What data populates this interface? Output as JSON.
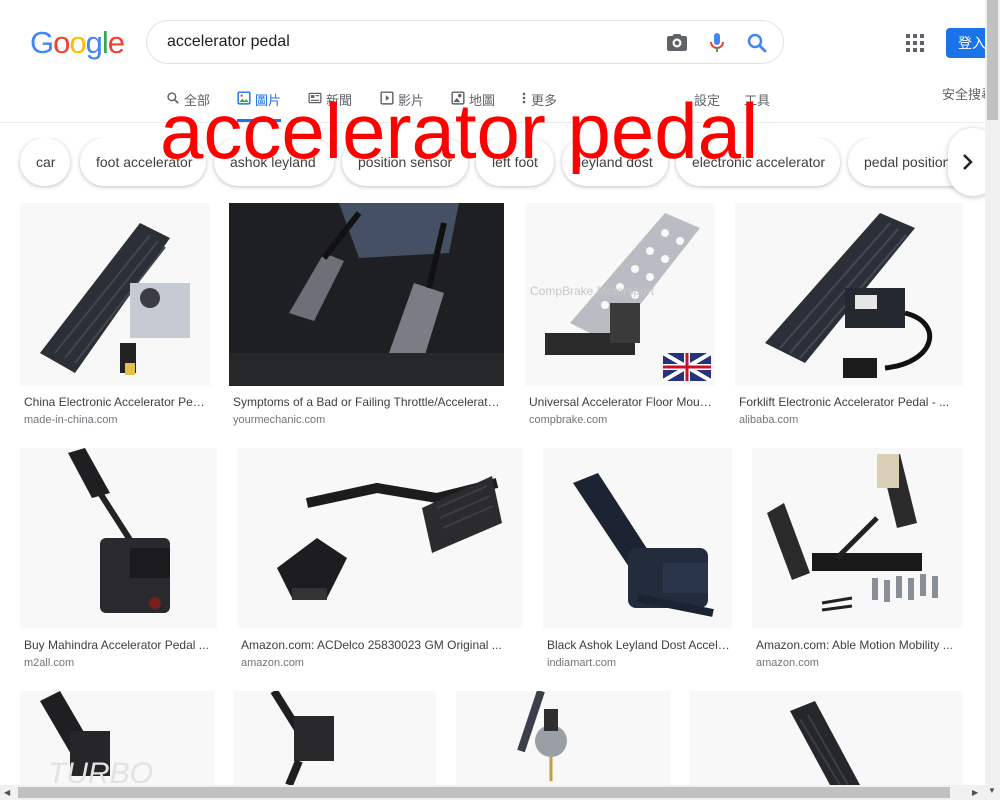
{
  "header": {
    "logo_letters": [
      "G",
      "o",
      "o",
      "g",
      "l",
      "e"
    ],
    "search_value": "accelerator pedal",
    "signin_label": "登入"
  },
  "tabs": [
    {
      "label": "全部",
      "icon": "search-icon"
    },
    {
      "label": "圖片",
      "icon": "image-icon",
      "active": true
    },
    {
      "label": "新聞",
      "icon": "news-icon"
    },
    {
      "label": "影片",
      "icon": "video-icon"
    },
    {
      "label": "地圖",
      "icon": "map-icon"
    },
    {
      "label": "更多",
      "icon": "more-vert-icon"
    }
  ],
  "tools": {
    "settings": "設定",
    "tools": "工具",
    "safesearch": "安全搜尋"
  },
  "chips": [
    "car",
    "foot accelerator",
    "ashok leyland",
    "position sensor",
    "left foot",
    "leyland dost",
    "electronic accelerator",
    "pedal position"
  ],
  "overlay_text": "accelerator pedal",
  "results": [
    {
      "title": "China Electronic Accelerator Pedal ...",
      "source": "made-in-china.com"
    },
    {
      "title": "Symptoms of a Bad or Failing Throttle/Accelerator ...",
      "source": "yourmechanic.com"
    },
    {
      "title": "Universal Accelerator Floor Mount ...",
      "source": "compbrake.com"
    },
    {
      "title": "Forklift Electronic Accelerator Pedal - ...",
      "source": "alibaba.com"
    },
    {
      "title": "Buy Mahindra Accelerator Pedal ...",
      "source": "m2all.com"
    },
    {
      "title": "Amazon.com: ACDelco 25830023 GM Original ...",
      "source": "amazon.com"
    },
    {
      "title": "Black Ashok Leyland Dost Accelerator ...",
      "source": "indiamart.com"
    },
    {
      "title": "Amazon.com: Able Motion Mobility ...",
      "source": "amazon.com"
    }
  ],
  "image_watermarks": {
    "compbrake": "CompBrake Motorsport",
    "bottom_left": "TURBO"
  },
  "colors": {
    "google_blue": "#4285F4",
    "google_red": "#EA4335",
    "google_yellow": "#FBBC05",
    "google_green": "#34A853",
    "accent": "#1a73e8",
    "overlay_red": "#ff0000"
  }
}
